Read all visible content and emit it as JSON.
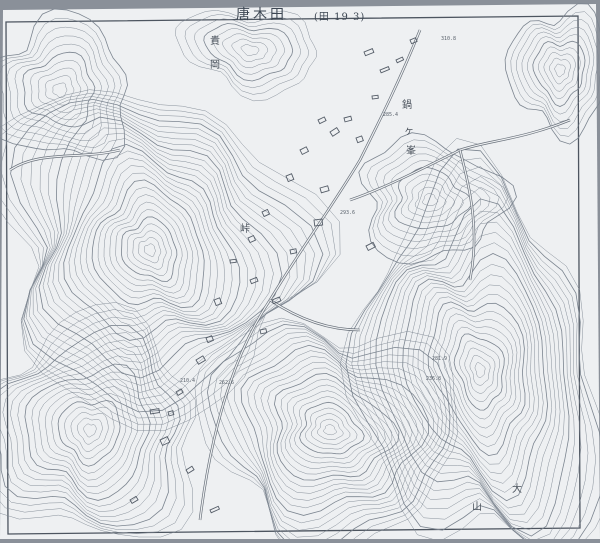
{
  "sheet": {
    "handwritten_title": "唐木田",
    "handwritten_code": "(田 19 3)"
  },
  "place_names": [
    "貴",
    "岡",
    "鍋",
    "ヶ",
    "峯",
    "山",
    "大",
    "峠"
  ],
  "elevation_labels": [
    "285.4",
    "310.8",
    "293.6",
    "236.8",
    "262.6",
    "210.4",
    "281.9"
  ],
  "colors": {
    "paper": "#eef0f2",
    "contour": "#7c8590",
    "road": "#6a727c",
    "building": "#555d68",
    "background": "#8a9099"
  }
}
